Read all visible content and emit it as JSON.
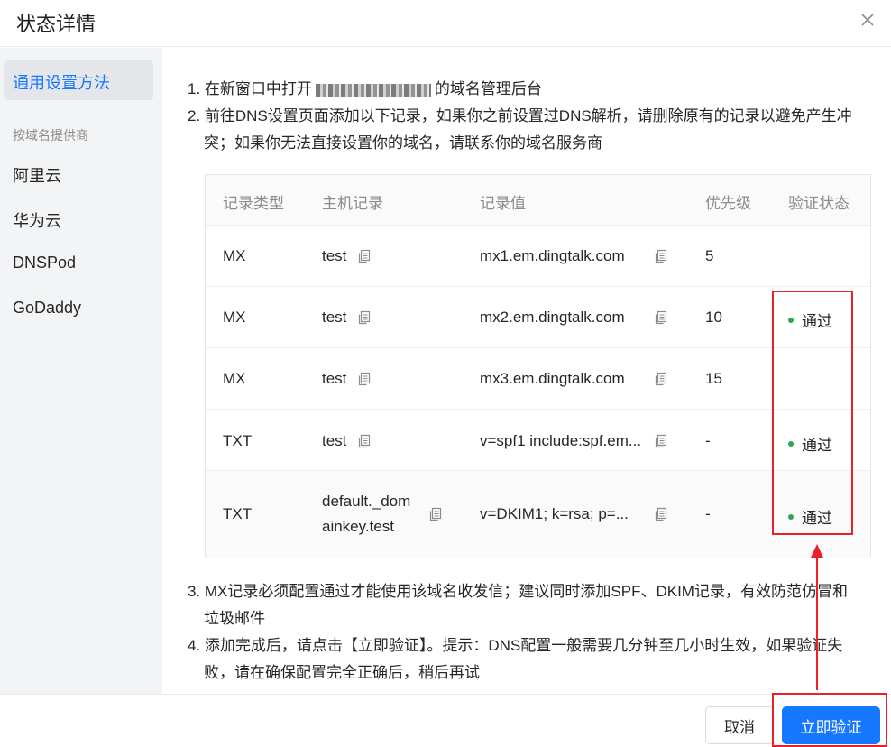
{
  "dialog": {
    "title": "状态详情",
    "close_icon": "close-icon"
  },
  "sidebar": {
    "active_label": "通用设置方法",
    "group_label": "按域名提供商",
    "providers": [
      "阿里云",
      "华为云",
      "DNSPod",
      "GoDaddy"
    ]
  },
  "steps": {
    "step1_prefix": "1. 在新窗口中打开",
    "step1_suffix": "的域名管理后台",
    "step2_line1": "2. 前往DNS设置页面添加以下记录，如果你之前设置过DNS解析，请删除原有的记录以避免产生冲",
    "step2_line2": "突；如果你无法直接设置你的域名，请联系你的域名服务商",
    "step3_line1": "3. MX记录必须配置通过才能使用该域名收发信；建议同时添加SPF、DKIM记录，有效防范仿冒和",
    "step3_line2": "垃圾邮件",
    "step4_line1": "4. 添加完成后，请点击【立即验证】。提示：DNS配置一般需要几分钟至几小时生效，如果验证失",
    "step4_line2": "败，请在确保配置完全正确后，稍后再试"
  },
  "table": {
    "headers": [
      "记录类型",
      "主机记录",
      "记录值",
      "优先级",
      "验证状态"
    ],
    "rows": [
      {
        "type": "MX",
        "host": "test",
        "value": "mx1.em.dingtalk.com",
        "priority": "5",
        "status": ""
      },
      {
        "type": "MX",
        "host": "test",
        "value": "mx2.em.dingtalk.com",
        "priority": "10",
        "status": "通过"
      },
      {
        "type": "MX",
        "host": "test",
        "value": "mx3.em.dingtalk.com",
        "priority": "15",
        "status": ""
      },
      {
        "type": "TXT",
        "host": "test",
        "value": "v=spf1 include:spf.em...",
        "priority": "-",
        "status": "通过"
      },
      {
        "type": "TXT",
        "host": "default._dom",
        "host2": "ainkey.test",
        "value": "v=DKIM1; k=rsa; p=...",
        "priority": "-",
        "status": "通过"
      }
    ]
  },
  "footer": {
    "cancel_label": "取消",
    "verify_label": "立即验证"
  },
  "colors": {
    "accent": "#1677ff",
    "status_ok": "#2da44e",
    "annotation": "#e8212a"
  }
}
